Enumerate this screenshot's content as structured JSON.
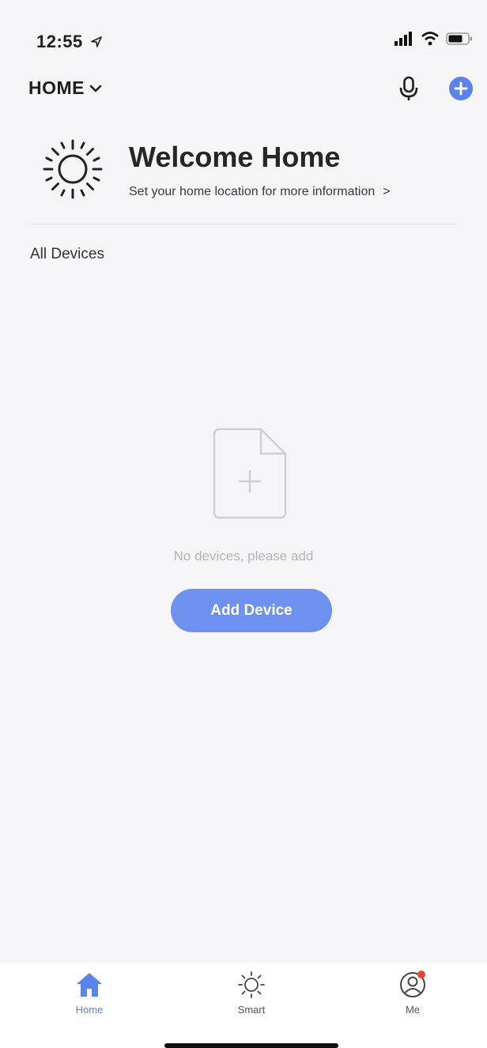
{
  "status_bar": {
    "time": "12:55",
    "icons": [
      "location-arrow-icon",
      "signal-icon",
      "wifi-icon",
      "battery-icon"
    ]
  },
  "header": {
    "home_label": "HOME",
    "icons": [
      "chevron-down-icon",
      "microphone-icon",
      "add-circle-icon"
    ]
  },
  "welcome": {
    "title": "Welcome Home",
    "subtitle": "Set your home location for more information",
    "chevron": ">"
  },
  "devices": {
    "section_label": "All Devices",
    "empty_text": "No devices, please add",
    "add_button": "Add Device"
  },
  "tabs": [
    {
      "label": "Home",
      "icon": "home-icon",
      "active": true
    },
    {
      "label": "Smart",
      "icon": "sun-icon",
      "active": false
    },
    {
      "label": "Me",
      "icon": "user-icon",
      "active": false,
      "badge": true
    }
  ],
  "colors": {
    "accent": "#5c82ec",
    "button": "#6e91ef",
    "background": "#f5f5f7",
    "badge": "#e8442f"
  }
}
